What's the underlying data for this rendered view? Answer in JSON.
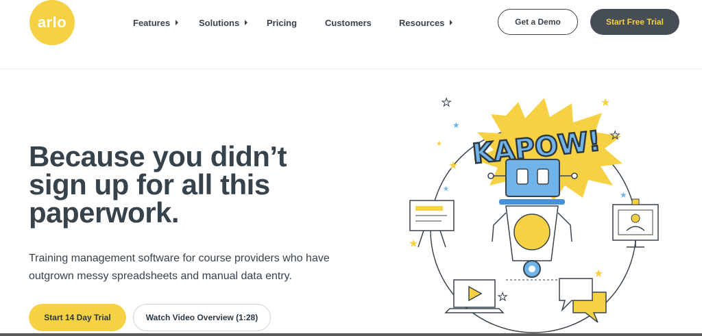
{
  "header": {
    "logo_text": "arlo",
    "nav": [
      {
        "label": "Features",
        "has_caret": true
      },
      {
        "label": "Solutions",
        "has_caret": true
      },
      {
        "label": "Pricing",
        "has_caret": false
      },
      {
        "label": "Customers",
        "has_caret": false
      },
      {
        "label": "Resources",
        "has_caret": true
      }
    ],
    "demo_label": "Get a Demo",
    "trial_label": "Start Free Trial"
  },
  "hero": {
    "headline": "Because you didn’t sign up for all this paperwork.",
    "subtext": "Training management software for course providers who have outgrown messy spreadsheets and manual data entry.",
    "primary_cta": "Start 14 Day Trial",
    "secondary_cta": "Watch Video Overview (1:28)",
    "illustration_text": "KAPOW!"
  },
  "colors": {
    "brand_yellow": "#f5d143",
    "dark": "#38424b",
    "robot_blue": "#6fb3e8",
    "accent_blue": "#4a90d9"
  }
}
